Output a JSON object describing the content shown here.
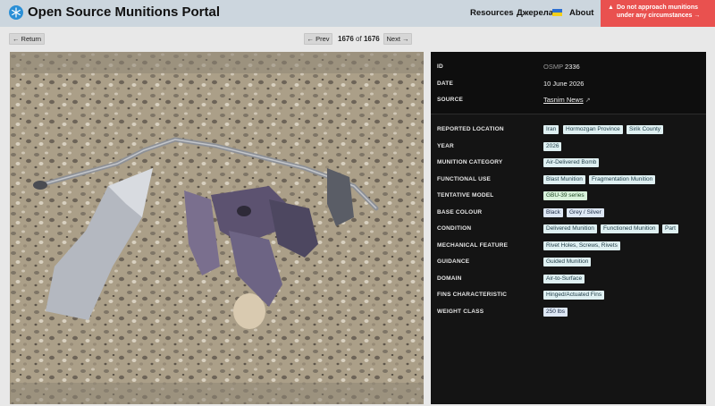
{
  "header": {
    "title": "Open Source Munitions Portal",
    "nav": {
      "resources": "Resources",
      "language": "Джерела",
      "about": "About"
    },
    "warning": {
      "icon": "▲",
      "text": "Do not approach munitions under any circumstances →"
    }
  },
  "toolbar": {
    "return_label": "← Return",
    "prev_label": "← Prev",
    "next_label": "Next →",
    "pager": {
      "current": "1676",
      "of": "of",
      "total": "1676"
    }
  },
  "record": {
    "id": {
      "label": "ID",
      "prefix": "OSMP",
      "value": "2336"
    },
    "date": {
      "label": "DATE",
      "value": "10 June 2026"
    },
    "source": {
      "label": "SOURCE",
      "value": "Tasnim News",
      "ext_icon": "↗"
    },
    "attributes": [
      {
        "label": "REPORTED LOCATION",
        "tags": [
          "Iran",
          "Hormozgan Province",
          "Sirik County"
        ]
      },
      {
        "label": "YEAR",
        "tags": [
          "2026"
        ]
      },
      {
        "label": "MUNITION CATEGORY",
        "tags": [
          "Air-Delivered Bomb"
        ]
      },
      {
        "label": "FUNCTIONAL USE",
        "tags": [
          "Blast Munition",
          "Fragmentation Munition"
        ]
      },
      {
        "label": "TENTATIVE MODEL",
        "tags": [
          "GBU-39 series"
        ]
      },
      {
        "label": "BASE COLOUR",
        "tags": [
          "Black",
          "Grey / Silver"
        ]
      },
      {
        "label": "CONDITION",
        "tags": [
          "Delivered Munition",
          "Functioned Munition",
          "Part"
        ]
      },
      {
        "label": "MECHANICAL FEATURE",
        "tags": [
          "Rivet Holes, Screws, Rivets"
        ]
      },
      {
        "label": "GUIDANCE",
        "tags": [
          "Guided Munition"
        ]
      },
      {
        "label": "DOMAIN",
        "tags": [
          "Air-to-Surface"
        ]
      },
      {
        "label": "FINS CHARACTERISTIC",
        "tags": [
          "Hinged/Actuated Fins"
        ]
      },
      {
        "label": "WEIGHT CLASS",
        "tags": [
          "250 lbs"
        ]
      }
    ]
  },
  "colors": {
    "header_bg": "#ccd6de",
    "warning_bg": "#e9514f",
    "panel_bg": "#141414",
    "tag_bg": "#dff0f2",
    "model_tag_bg": "#d9f2dc"
  },
  "icons": {
    "logo": "snowflake-logo-icon",
    "flag": "ukraine-flag-icon",
    "warning": "warning-triangle-icon",
    "external": "external-link-icon"
  }
}
